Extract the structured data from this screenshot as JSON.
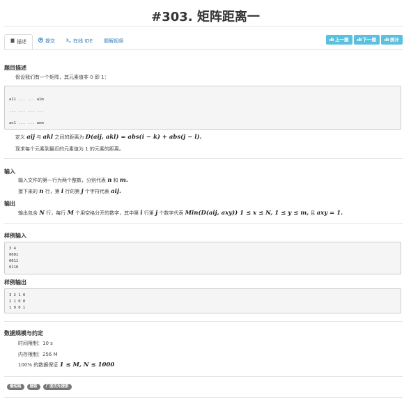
{
  "page": {
    "title": "#303. 矩阵距离一"
  },
  "tabs": [
    {
      "label": "描述",
      "icon": "file-icon"
    },
    {
      "label": "提交",
      "icon": "upload-icon"
    },
    {
      "label": "在线 IDE",
      "icon": "terminal-icon"
    },
    {
      "label": "题解视频",
      "icon": ""
    }
  ],
  "nav": {
    "prev": "上一题",
    "next": "下一题",
    "stats": "统计"
  },
  "description": {
    "heading": "题目描述",
    "intro": "假设我们有一个矩阵，其元素值非 0 即 1：",
    "matrix": [
      "a11 ... ... a1m",
      "... ... ... ...",
      "an1 ... ... anm"
    ],
    "def_prefix": "定义",
    "def_var1": "aij",
    "def_mid1": "与",
    "def_var2": "akl",
    "def_mid2": "之间的距离为",
    "def_formula": "D(aij, akl) = abs(i − k) + abs(j − l).",
    "ask": "现求每个元素到最近的元素值为 1 的元素的距离。"
  },
  "input": {
    "heading": "输入",
    "line1_prefix": "输入文件的第一行为两个整数，分别代表",
    "line1_n": "n",
    "line1_and": "和",
    "line1_m": "m.",
    "line2_prefix": "接下来的",
    "line2_n": "n",
    "line2_mid": "行，第",
    "line2_i": "i",
    "line2_mid2": "行的第",
    "line2_j": "j",
    "line2_mid3": "个字符代表",
    "line2_aij": "aij."
  },
  "output": {
    "heading": "输出",
    "t1": "输出包含",
    "N": "N",
    "t2": "行，每行",
    "M": "M",
    "t3": "个用空格分开的数字，其中第",
    "i": "i",
    "t4": "行第",
    "j": "j",
    "t5": "个数字代表",
    "formula": "Min(D(aij, axy)) 1 ≤ x ≤ N, 1 ≤ y ≤ m,",
    "t6": "且",
    "formula2": "axy = 1."
  },
  "sample_input": {
    "heading": "样例输入",
    "lines": [
      "3 4",
      "0001",
      "0011",
      "0110"
    ]
  },
  "sample_output": {
    "heading": "样例输出",
    "lines": [
      "3 2 1 0",
      "2 1 0 0",
      "1 0 0 1"
    ]
  },
  "limits": {
    "heading": "数据规模与约定",
    "time": "时间限制：10 s",
    "memory": "内存限制：256 M",
    "guarantee_prefix": "100% 的数据保证",
    "guarantee_formula": "1 ≤ M, N ≤ 1000"
  },
  "tags": [
    "最短路",
    "搜索",
    "广度优先搜索"
  ],
  "colors": {
    "nav_button": "#5bc0de",
    "link": "#337ab7",
    "tag": "#777777"
  }
}
